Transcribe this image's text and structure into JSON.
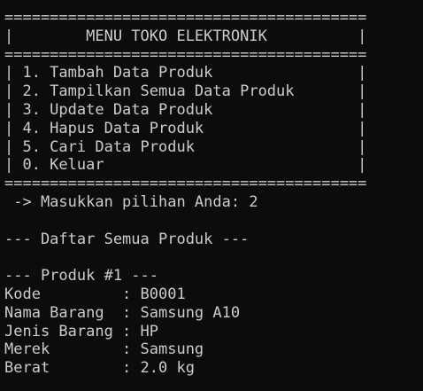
{
  "terminal": {
    "lines": [
      "========================================",
      "|        MENU TOKO ELEKTRONIK          |",
      "========================================",
      "| 1. Tambah Data Produk                |",
      "| 2. Tampilkan Semua Data Produk       |",
      "| 3. Update Data Produk                |",
      "| 4. Hapus Data Produk                 |",
      "| 5. Cari Data Produk                  |",
      "| 0. Keluar                            |",
      "========================================",
      " -> Masukkan pilihan Anda: 2",
      "",
      "--- Daftar Semua Produk ---",
      "",
      "--- Produk #1 ---",
      "Kode         : B0001",
      "Nama Barang  : Samsung A10",
      "Jenis Barang : HP",
      "Merek        : Samsung",
      "Berat        : 2.0 kg"
    ]
  }
}
